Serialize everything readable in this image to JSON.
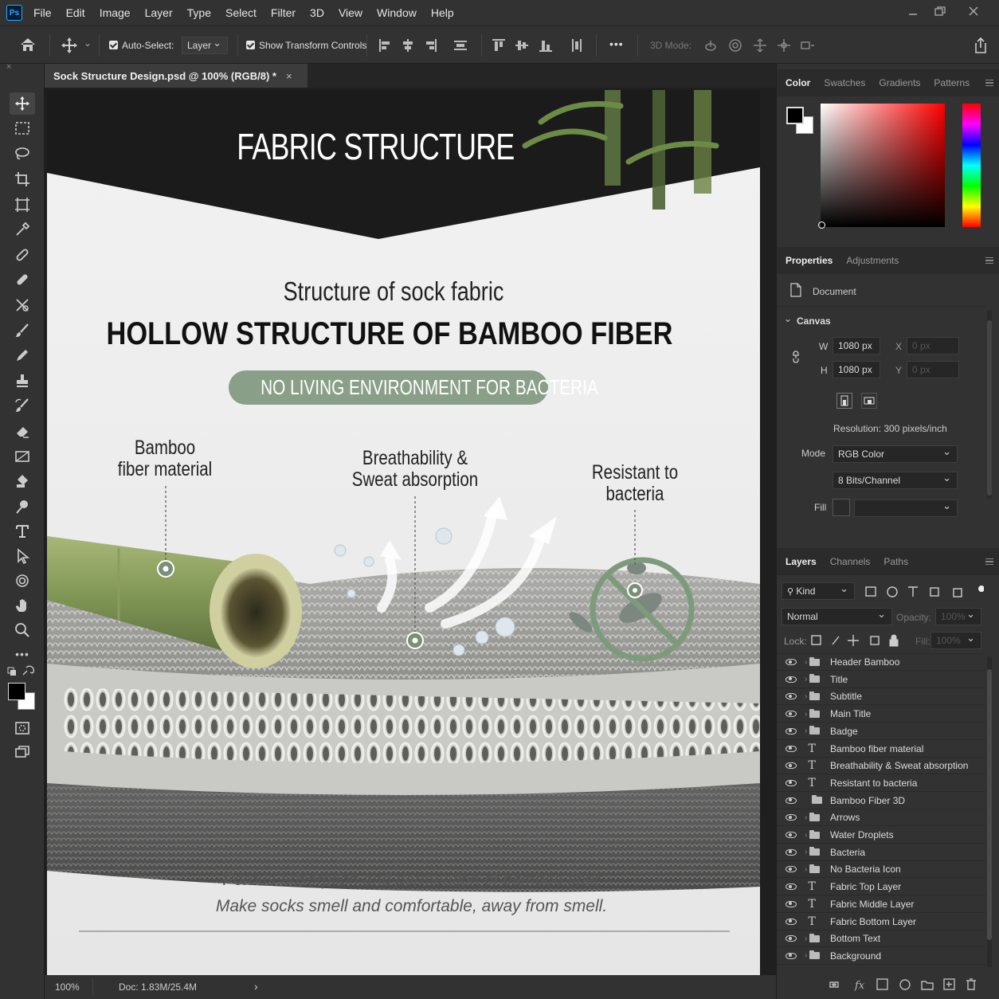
{
  "app": {
    "logo_text": "Ps"
  },
  "menu": [
    "File",
    "Edit",
    "Image",
    "Layer",
    "Type",
    "Select",
    "Filter",
    "3D",
    "View",
    "Window",
    "Help"
  ],
  "options": {
    "auto_select_label": "Auto-Select:",
    "auto_select_value": "Layer",
    "show_transform_label": "Show Transform Controls",
    "mode_3d_label": "3D Mode:",
    "more": "•••"
  },
  "document": {
    "tab_title": "Sock Structure Design.psd @ 100% (RGB/8) *",
    "close": "×"
  },
  "canvas": {
    "header_title": "FABRIC STRUCTURE",
    "subtitle": "Structure of sock fabric",
    "main_title": "HOLLOW STRUCTURE OF BAMBOO FIBER",
    "badge": "NO LIVING ENVIRONMENT FOR BACTERIA",
    "callout1_line1": "Bamboo",
    "callout1_line2": "fiber material",
    "callout2_line1": "Breathability &",
    "callout2_line2": "Sweat absorption",
    "callout3_line1": "Resistant to",
    "callout3_line2": "bacteria",
    "bottom_line1": "Porous adsorption and permeation of bamboo fiber",
    "bottom_line2": "Make socks smell and comfortable, away from smell.",
    "accent": "#8a9f88",
    "header_bg": "#1d1d1d"
  },
  "status": {
    "zoom": "100%",
    "doc": "Doc: 1.83M/25.4M",
    "arrow": "›"
  },
  "color_panel": {
    "tabs": [
      "Color",
      "Swatches",
      "Gradients",
      "Patterns"
    ]
  },
  "properties_panel": {
    "tabs": [
      "Properties",
      "Adjustments"
    ],
    "document_label": "Document",
    "canvas_label": "Canvas",
    "w_label": "W",
    "w_value": "1080 px",
    "h_label": "H",
    "h_value": "1080 px",
    "x_label": "X",
    "x_placeholder": "0 px",
    "y_label": "Y",
    "y_placeholder": "0 px",
    "resolution": "Resolution: 300 pixels/inch",
    "mode_label": "Mode",
    "mode_value": "RGB Color",
    "bits_value": "8 Bits/Channel",
    "fill_label": "Fill"
  },
  "layers_panel": {
    "tabs": [
      "Layers",
      "Channels",
      "Paths"
    ],
    "kind_label": "Kind",
    "blend_mode": "Normal",
    "opacity_label": "Opacity:",
    "opacity_value": "100%",
    "lock_label": "Lock:",
    "fill_label": "Fill:",
    "fill_value": "100%",
    "layers": [
      {
        "name": "Header Bamboo",
        "type": "group"
      },
      {
        "name": "Title",
        "type": "group"
      },
      {
        "name": "Subtitle",
        "type": "group"
      },
      {
        "name": "Main Title",
        "type": "group"
      },
      {
        "name": "Badge",
        "type": "group"
      },
      {
        "name": "Bamboo fiber material",
        "type": "text"
      },
      {
        "name": "Breathability & Sweat absorption",
        "type": "text"
      },
      {
        "name": "Resistant to bacteria",
        "type": "text"
      },
      {
        "name": "Bamboo Fiber 3D",
        "type": "folder"
      },
      {
        "name": "Arrows",
        "type": "group"
      },
      {
        "name": "Water Droplets",
        "type": "group"
      },
      {
        "name": "Bacteria",
        "type": "group"
      },
      {
        "name": "No Bacteria Icon",
        "type": "group"
      },
      {
        "name": "Fabric Top Layer",
        "type": "text"
      },
      {
        "name": "Fabric Middle Layer",
        "type": "text"
      },
      {
        "name": "Fabric Bottom Layer",
        "type": "text"
      },
      {
        "name": "Bottom Text",
        "type": "group"
      },
      {
        "name": "Background",
        "type": "group"
      }
    ]
  }
}
